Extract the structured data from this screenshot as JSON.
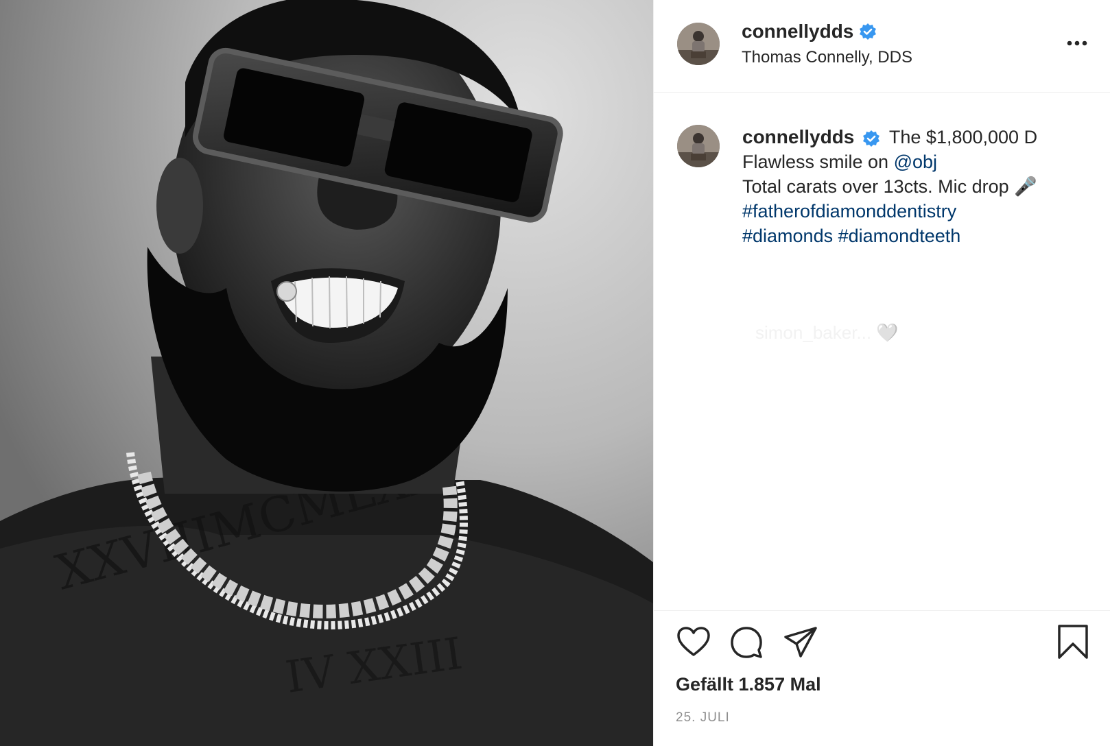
{
  "header": {
    "username": "connellydds",
    "subtitle": "Thomas Connelly, DDS",
    "more_icon": "more-horizontal-icon"
  },
  "caption": {
    "username": "connellydds",
    "line1": "The $1,800,000 D",
    "line2_prefix": "Flawless smile on ",
    "mention": "@obj",
    "line3": "Total carats over 13cts. Mic drop",
    "mic_icon": "🎤",
    "hashtag1": "#fatherofdiamonddentistry",
    "hashtag2": "#diamonds",
    "hashtag3": "#diamondteeth"
  },
  "ghost_comment": "simon_baker... 🤍",
  "actions": {
    "like_icon": "heart-icon",
    "comment_icon": "comment-icon",
    "share_icon": "send-icon",
    "save_icon": "bookmark-icon",
    "likes_text": "Gefällt 1.857 Mal",
    "date": "25. JULI"
  },
  "colors": {
    "text": "#262626",
    "link": "#00376b",
    "verified": "#3897f0",
    "muted": "#8e8e8e",
    "divider": "#efefef"
  }
}
